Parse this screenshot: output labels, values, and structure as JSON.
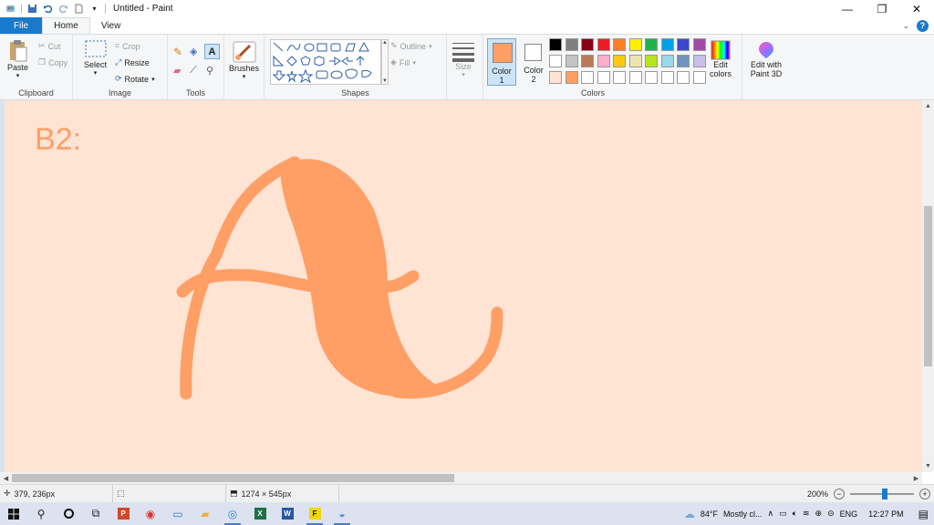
{
  "window": {
    "title": "Untitled - Paint"
  },
  "tabs": {
    "file": "File",
    "home": "Home",
    "view": "View"
  },
  "clipboard": {
    "paste": "Paste",
    "cut": "Cut",
    "copy": "Copy",
    "label": "Clipboard"
  },
  "image": {
    "select": "Select",
    "crop": "Crop",
    "resize": "Resize",
    "rotate": "Rotate",
    "label": "Image"
  },
  "tools": {
    "label": "Tools"
  },
  "brushes": {
    "label": "Brushes"
  },
  "shapes": {
    "label": "Shapes",
    "outline": "Outline",
    "fill": "Fill"
  },
  "size": {
    "label": "Size"
  },
  "colors": {
    "color1_label": "Color\n1",
    "color1_a": "Color",
    "color1_b": "1",
    "color2_a": "Color",
    "color2_b": "2",
    "label": "Colors",
    "edit_a": "Edit",
    "edit_b": "colors",
    "paint3d_a": "Edit with",
    "paint3d_b": "Paint 3D",
    "color1_value": "#ff9f66",
    "color2_value": "#ffffff",
    "palette": [
      "#000000",
      "#7f7f7f",
      "#880015",
      "#ed1c24",
      "#ff7f27",
      "#fff200",
      "#22b14c",
      "#00a2e8",
      "#3f48cc",
      "#a349a4",
      "#ffffff",
      "#c3c3c3",
      "#b97a57",
      "#ffaec9",
      "#ffc90e",
      "#efe4b0",
      "#b5e61d",
      "#99d9ea",
      "#7092be",
      "#c8bfe7",
      "#ffe4d4",
      "#ff9f66",
      "#ffffff",
      "#ffffff",
      "#ffffff",
      "#ffffff",
      "#ffffff",
      "#ffffff",
      "#ffffff",
      "#ffffff"
    ]
  },
  "canvas": {
    "text": "B2:",
    "bg": "#ffe4d4",
    "stroke": "#ff9f66"
  },
  "status": {
    "cursor": "379, 236px",
    "size": "1274 × 545px",
    "zoom": "200%"
  },
  "taskbar": {
    "weather_temp": "84°F",
    "weather_text": "Mostly cl...",
    "lang": "ENG",
    "time": "12:27 PM"
  }
}
